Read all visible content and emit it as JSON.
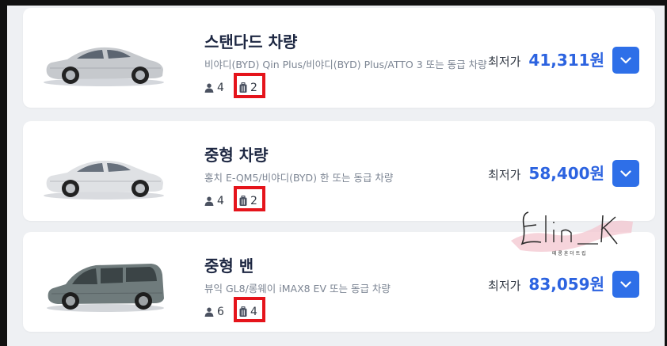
{
  "currency_prefix": "최저가",
  "colors": {
    "accent": "#2e6fe8",
    "price": "#2c63e0",
    "highlight": "#e5141b"
  },
  "icons": {
    "passengers": "person-icon",
    "luggage": "luggage-icon",
    "expand": "chevron-down-icon"
  },
  "cars": [
    {
      "title": "스탠다드 차량",
      "description": "비야디(BYD) Qin Plus/비야디(BYD) Plus/ATTO 3 또는 동급 차량",
      "passengers": "4",
      "luggage": "2",
      "price_label": "최저가",
      "price": "41,311원"
    },
    {
      "title": "중형 차량",
      "description": "홍치 E-QM5/비야디(BYD) 한 또는 동급 차량",
      "passengers": "4",
      "luggage": "2",
      "price_label": "최저가",
      "price": "58,400원"
    },
    {
      "title": "중형 밴",
      "description": "뷰익 GL8/롱웨이 iMAX8 EV 또는 동급 차량",
      "passengers": "6",
      "luggage": "4",
      "price_label": "최저가",
      "price": "83,059원"
    }
  ],
  "watermark": {
    "name": "Elin_K",
    "tagline": "떼 롱 혼 더 트 립"
  }
}
